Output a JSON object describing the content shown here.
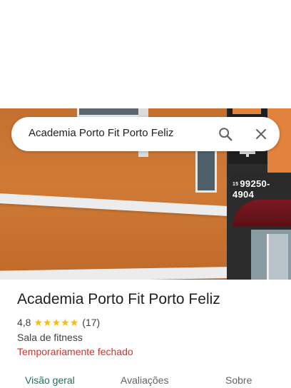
{
  "search": {
    "query": "Academia Porto Fit Porto Feliz"
  },
  "photo": {
    "sign_prefix": "15",
    "sign_phone": "99250-4904"
  },
  "place": {
    "name": "Academia Porto Fit Porto Feliz",
    "rating": "4,8",
    "stars": [
      "★",
      "★",
      "★",
      "★",
      "★"
    ],
    "review_count": "(17)",
    "category": "Sala de fitness",
    "status": "Temporariamente fechado"
  },
  "tabs": {
    "overview": "Visão geral",
    "reviews": "Avaliações",
    "about": "Sobre"
  },
  "colors": {
    "accent": "#1a7358",
    "star": "#fbbc04",
    "status_closed": "#d93025"
  },
  "icons": {
    "search": "search-icon",
    "close": "close-icon"
  }
}
